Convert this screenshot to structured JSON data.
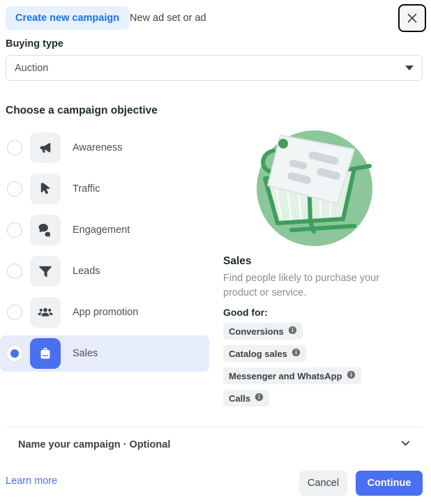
{
  "header": {
    "active_tab": "Create new campaign",
    "secondary_tab": "New ad set or ad",
    "close_icon": "close-icon",
    "accent_color": "#1b74e4",
    "pill_bg": "#e7f0fd"
  },
  "buying_type": {
    "label": "Buying type",
    "value": "Auction",
    "caret_icon": "chevron-down-icon"
  },
  "objective": {
    "heading": "Choose a campaign objective",
    "selected_index": 5,
    "items": [
      {
        "label": "Awareness",
        "icon": "megaphone-icon",
        "selected": false
      },
      {
        "label": "Traffic",
        "icon": "cursor-arrow-icon",
        "selected": false
      },
      {
        "label": "Engagement",
        "icon": "chat-bubbles-icon",
        "selected": false
      },
      {
        "label": "Leads",
        "icon": "funnel-icon",
        "selected": false
      },
      {
        "label": "App promotion",
        "icon": "people-group-icon",
        "selected": false
      },
      {
        "label": "Sales",
        "icon": "shopping-bag-icon",
        "selected": true
      }
    ],
    "selected_bg": "#e7ecfb",
    "selected_tile_color": "#4a6ff0"
  },
  "detail": {
    "illustration": "shopping-cart-with-price-tag-illustration",
    "illustration_bg": "#8bc79a",
    "title": "Sales",
    "description": "Find people likely to purchase your product or service.",
    "good_for_label": "Good for:",
    "chips": [
      {
        "label": "Conversions",
        "icon": "info-icon"
      },
      {
        "label": "Catalog sales",
        "icon": "info-icon"
      },
      {
        "label": "Messenger and WhatsApp",
        "icon": "info-icon"
      },
      {
        "label": "Calls",
        "icon": "info-icon"
      }
    ]
  },
  "name_section": {
    "label": "Name your campaign · Optional",
    "chevron_icon": "chevron-down-icon"
  },
  "footer": {
    "learn_more": "Learn more",
    "cancel": "Cancel",
    "continue": "Continue",
    "continue_color": "#4a6ff0",
    "link_color": "#4a6fe8"
  }
}
